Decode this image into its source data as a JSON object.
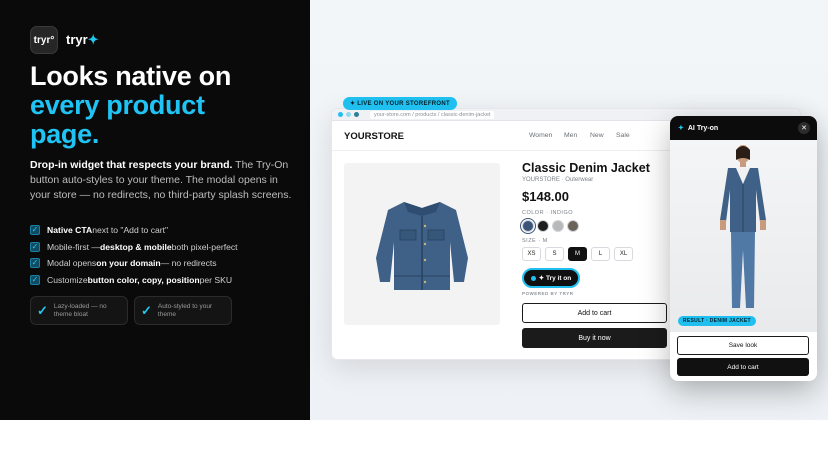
{
  "brand": {
    "logo_text": "tryr°",
    "name": "tryr",
    "spark": "✦"
  },
  "hero": {
    "line1": "Looks native on",
    "line2": "every product",
    "line3": "page.",
    "desc_bold": "Drop-in widget that respects your brand.",
    "desc_rest": " The Try-On button auto-styles to your theme. The modal opens in your store — no redirects, no third-party splash screens."
  },
  "features": [
    {
      "bold": "Native CTA",
      "rest": " next to \"Add to cart\""
    },
    {
      "pre": "Mobile-first — ",
      "bold": "desktop & mobile",
      "rest": " both pixel-perfect"
    },
    {
      "pre": "Modal opens ",
      "bold": "on your domain",
      "rest": " — no redirects"
    },
    {
      "pre": "Customize ",
      "bold": "button color, copy, position",
      "rest": " per SKU"
    }
  ],
  "pills": [
    {
      "text": "Lazy-loaded — no theme bloat"
    },
    {
      "text": "Auto-styled to your theme"
    }
  ],
  "live_badge": "✦ LIVE ON YOUR STOREFRONT",
  "browser": {
    "url": "your-store.com / products / classic-denim-jacket",
    "store_name": "YOURSTORE",
    "nav": [
      "Women",
      "Men",
      "New",
      "Sale"
    ]
  },
  "product": {
    "title": "Classic Denim Jacket",
    "subtitle": "YOURSTORE · Outerwear",
    "price": "$148.00",
    "color_label": "COLOR · INDIGO",
    "swatches": [
      "#3b5578",
      "#1e1e1e",
      "#b9b9b9",
      "#6b625a"
    ],
    "size_label": "SIZE · M",
    "sizes": [
      "XS",
      "S",
      "M",
      "L",
      "XL"
    ],
    "selected_size": "M",
    "tryon_label": "✦ Try it on",
    "powered": "POWERED BY TRYR",
    "add_to_cart": "Add to cart",
    "buy_now": "Buy it now"
  },
  "modal": {
    "title": "AI Try-on",
    "spark": "✦",
    "close": "✕",
    "result_badge": "RESULT · DENIM JACKET",
    "save_look": "Save look",
    "add_to_cart": "Add to cart"
  },
  "colors": {
    "accent": "#1fc0ef",
    "dark": "#0a0a0a"
  }
}
